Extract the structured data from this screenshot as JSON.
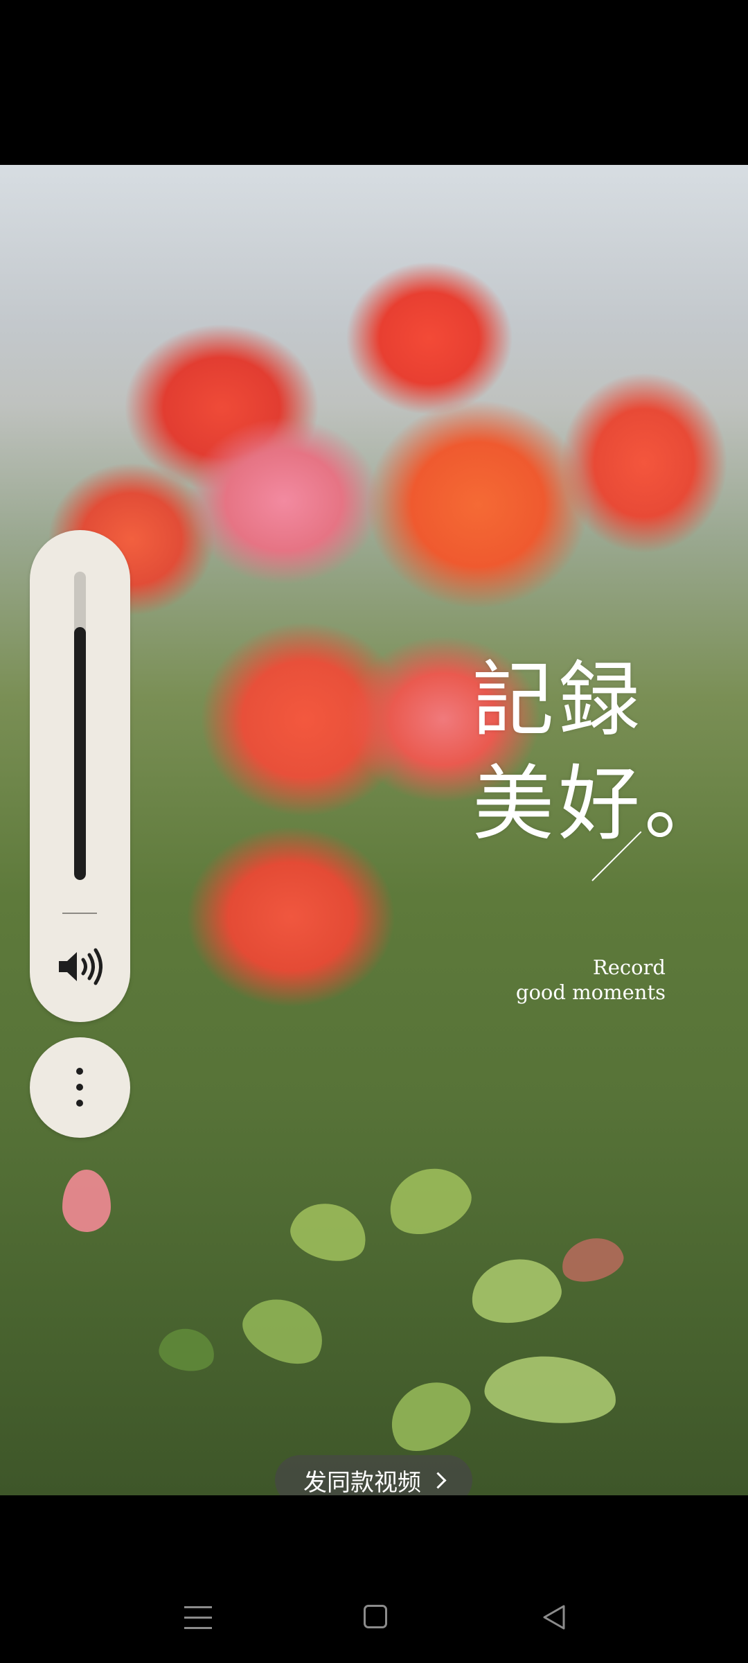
{
  "overlay": {
    "title_line1": "記録",
    "title_line2": "美好。",
    "subtitle_line1": "Record",
    "subtitle_line2": "good moments"
  },
  "volume": {
    "level": 0.82,
    "icon": "speaker-volume-icon"
  },
  "more_button": {
    "icon": "more-vertical-icon"
  },
  "cta": {
    "label": "发同款视频",
    "icon": "chevron-right-icon"
  },
  "navigation": {
    "menu_icon": "menu-icon",
    "home_icon": "home-icon",
    "back_icon": "back-icon"
  },
  "colors": {
    "panel": "#eeeae2",
    "fill": "#1e1e1e",
    "overlay_text": "#ffffff"
  }
}
